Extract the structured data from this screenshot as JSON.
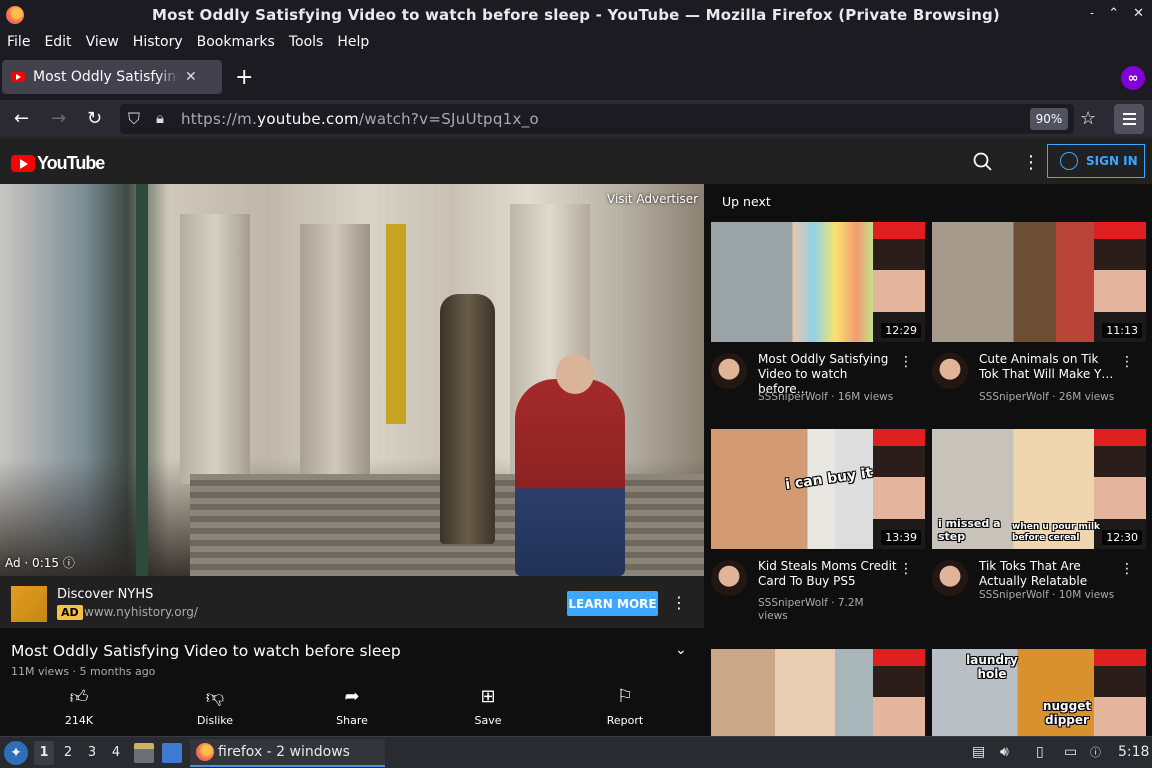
{
  "window": {
    "title": "Most Oddly Satisfying Video to watch before sleep - YouTube — Mozilla Firefox (Private Browsing)",
    "controls": [
      "˗",
      "⌃",
      "✕"
    ]
  },
  "menubar": [
    "File",
    "Edit",
    "View",
    "History",
    "Bookmarks",
    "Tools",
    "Help"
  ],
  "tabs": [
    {
      "title": "Most Oddly Satisfying Vic",
      "close": "✕"
    }
  ],
  "newtab_label": "+",
  "private_badge": "∞",
  "navbar": {
    "back": "←",
    "forward": "→",
    "reload": "↻",
    "url_prefix": "https://m.",
    "url_domain": "youtube.com",
    "url_path": "/watch?v=SJuUtpq1x_o",
    "zoom": "90%",
    "bookmark_star": "☆"
  },
  "youtube": {
    "logo_text": "YouTube",
    "kebab": "⋮",
    "signin_label": "SIGN IN",
    "player": {
      "visit_advertiser": "Visit Advertiser",
      "ad_time": "Ad · 0:15 ⓘ"
    },
    "ad": {
      "title": "Discover NYHS",
      "badge": "AD",
      "url": "www.nyhistory.org/",
      "cta": "LEARN MORE",
      "kebab": "⋮"
    },
    "video": {
      "title": "Most Oddly Satisfying Video to watch before sleep",
      "meta": "11M views · 5 months ago",
      "expand": "⌄"
    },
    "actions": [
      {
        "icon": "thumbs-up-icon",
        "glyph": "👍︎",
        "label": "214K"
      },
      {
        "icon": "thumbs-down-icon",
        "glyph": "👎︎",
        "label": "Dislike"
      },
      {
        "icon": "share-icon",
        "glyph": "➦",
        "label": "Share"
      },
      {
        "icon": "save-icon",
        "glyph": "⊞",
        "label": "Save"
      },
      {
        "icon": "flag-icon",
        "glyph": "⚐",
        "label": "Report"
      }
    ],
    "up_next_label": "Up next",
    "cards": [
      {
        "title": "Most Oddly Satisfying Video to watch before…",
        "channel": "SSSniperWolf · 16M views",
        "duration": "12:29"
      },
      {
        "title": "Cute Animals on Tik Tok That Will Make Y…",
        "channel": "SSSniperWolf · 26M views",
        "duration": "11:13"
      },
      {
        "title": "Kid Steals Moms Credit Card To Buy PS5",
        "channel": "SSSniperWolf · 7.2M views",
        "duration": "13:39",
        "overlay": "i can buy it"
      },
      {
        "title": "Tik Toks That Are Actually Relatable",
        "channel": "SSSniperWolf · 10M views",
        "duration": "12:30",
        "overlay": "i missed a step",
        "overlay2": "when u pour milk before cereal"
      },
      {
        "title": "",
        "channel": "",
        "duration": ""
      },
      {
        "title": "",
        "channel": "",
        "duration": "",
        "overlay": "laundry hole",
        "overlay2": "nugget dipper"
      }
    ]
  },
  "taskbar": {
    "workspaces": [
      "1",
      "2",
      "3",
      "4"
    ],
    "task_label": "firefox - 2 windows",
    "clock": "5:18",
    "volume": "🔊︎"
  }
}
